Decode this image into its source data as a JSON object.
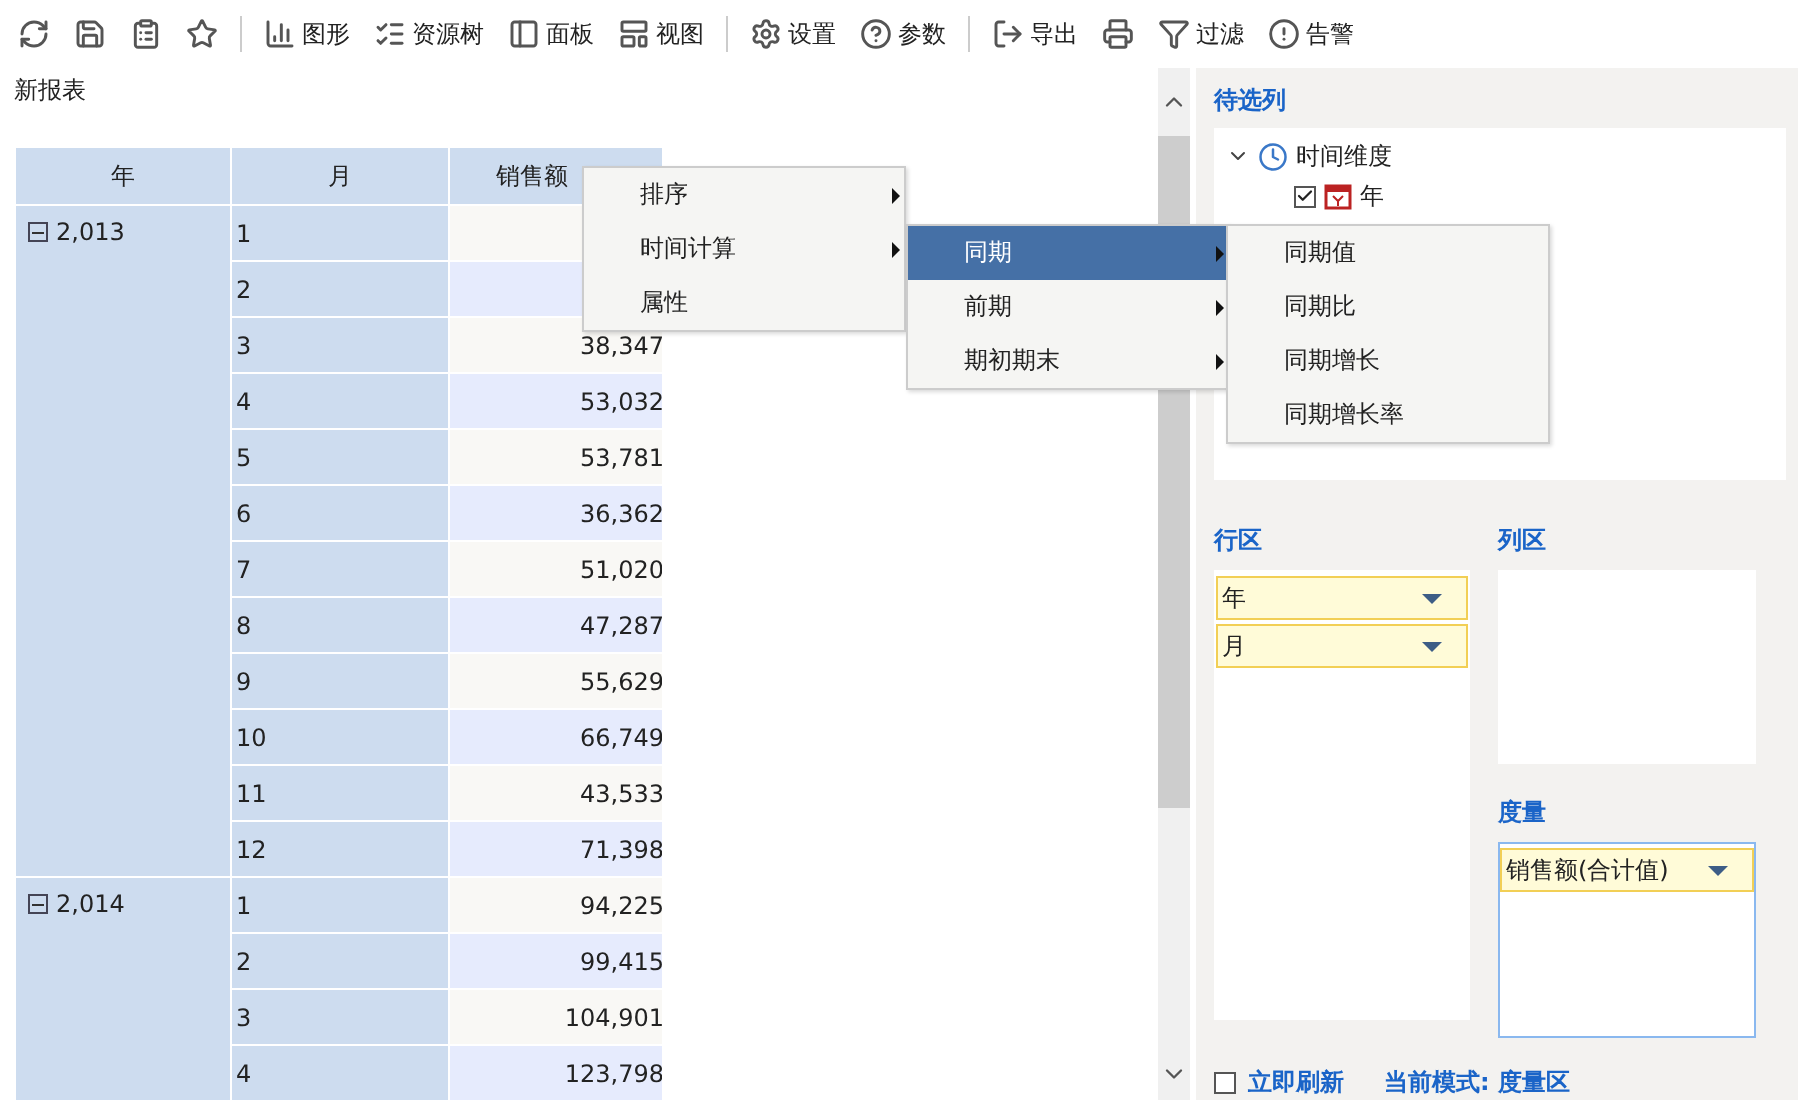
{
  "toolbar": [
    [
      {
        "kind": "refresh"
      },
      {
        "kind": "save"
      },
      {
        "kind": "saveas"
      },
      {
        "kind": "star"
      }
    ],
    [
      {
        "kind": "chart",
        "label": "图形"
      },
      {
        "kind": "tree",
        "label": "资源树"
      },
      {
        "kind": "panel",
        "label": "面板"
      },
      {
        "kind": "view",
        "label": "视图"
      }
    ],
    [
      {
        "kind": "gear",
        "label": "设置"
      },
      {
        "kind": "help",
        "label": "参数"
      }
    ],
    [
      {
        "kind": "export",
        "label": "导出"
      },
      {
        "kind": "print"
      },
      {
        "kind": "filter",
        "label": "过滤"
      },
      {
        "kind": "alert",
        "label": "告警"
      }
    ]
  ],
  "report_title": "新报表",
  "table": {
    "columns": [
      "年",
      "月",
      "销售额"
    ],
    "groups": [
      {
        "year": "2,013",
        "expanded": true,
        "rows": [
          {
            "month": "1"
          },
          {
            "month": "2"
          },
          {
            "month": "3",
            "value": "38,347"
          },
          {
            "month": "4",
            "value": "53,032"
          },
          {
            "month": "5",
            "value": "53,781"
          },
          {
            "month": "6",
            "value": "36,362"
          },
          {
            "month": "7",
            "value": "51,020"
          },
          {
            "month": "8",
            "value": "47,287"
          },
          {
            "month": "9",
            "value": "55,629"
          },
          {
            "month": "10",
            "value": "66,749"
          },
          {
            "month": "11",
            "value": "43,533"
          },
          {
            "month": "12",
            "value": "71,398"
          }
        ]
      },
      {
        "year": "2,014",
        "expanded": true,
        "rows": [
          {
            "month": "1",
            "value": "94,225"
          },
          {
            "month": "2",
            "value": "99,415"
          },
          {
            "month": "3",
            "value": "104,901"
          },
          {
            "month": "4",
            "value": "123,798"
          }
        ]
      }
    ]
  },
  "context_menu": [
    {
      "label": "排序",
      "submenu": true,
      "selected": false
    },
    {
      "label": "时间计算",
      "submenu": true,
      "selected": false
    },
    {
      "label": "属性",
      "submenu": false,
      "selected": false
    }
  ],
  "submenu": [
    {
      "label": "同期",
      "submenu": true,
      "selected": true
    },
    {
      "label": "前期",
      "submenu": true,
      "selected": false
    },
    {
      "label": "期初期末",
      "submenu": true,
      "selected": false
    }
  ],
  "submenu_2": [
    {
      "label": "同期值",
      "selected": false
    },
    {
      "label": "同期比",
      "selected": false
    },
    {
      "label": "同期增长",
      "selected": false
    },
    {
      "label": "同期增长率",
      "selected": false
    }
  ],
  "candidates": {
    "title": "待选列",
    "tree": [
      {
        "label": "时间维度",
        "expanded": true,
        "children": [
          {
            "label": "年",
            "checked": true
          }
        ]
      }
    ]
  },
  "row_area": {
    "title": "行区",
    "fields": [
      "年",
      "月"
    ]
  },
  "column_area": {
    "title": "列区"
  },
  "measure_area": {
    "title": "度量",
    "fields": [
      "销售额(合计值)"
    ]
  },
  "footer": {
    "refresh_label": "立即刷新",
    "refresh_checked": false,
    "mode": "当前模式: 度量区"
  }
}
